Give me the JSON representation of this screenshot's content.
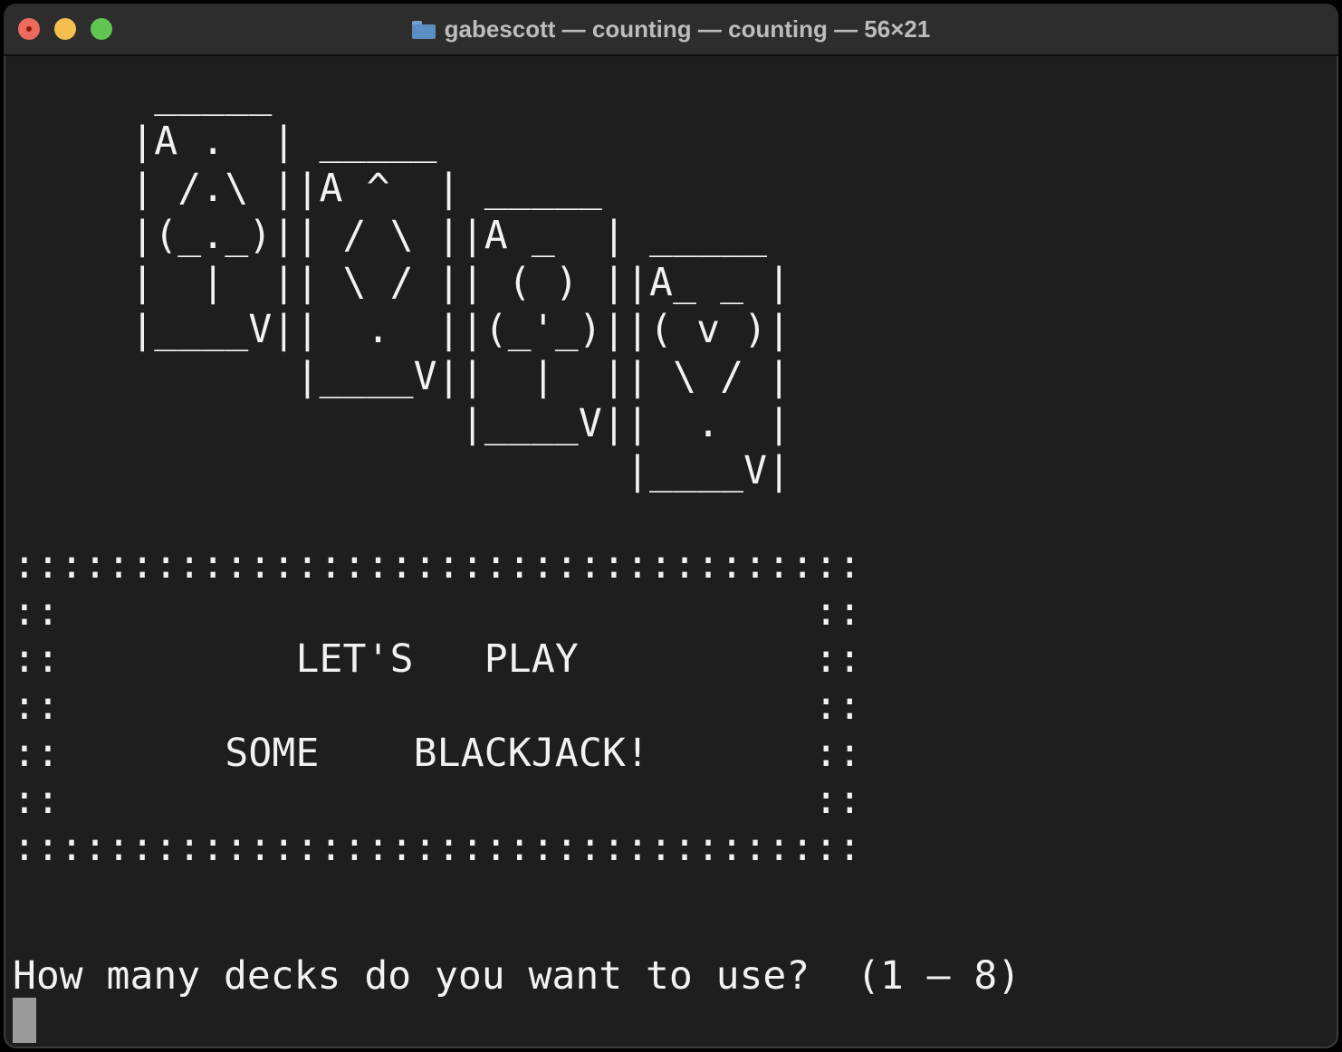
{
  "window": {
    "title": "gabescott — counting — counting — 56×21",
    "title_icon": "folder-icon",
    "buttons": [
      "close-button",
      "minimize-button",
      "maximize-button"
    ]
  },
  "terminal": {
    "ascii_art": "      _____\n     |A .  | _____\n     | /.\\ ||A ^  | _____\n     |(_._)|| / \\ ||A _  | _____\n     |  |  || \\ / || ( ) ||A_ _ |\n     |____V||  .  ||(_'_)||( v )|\n            |____V||  |  || \\ / |\n                   |____V||  .  |\n                          |____V|\n\n::::::::::::::::::::::::::::::::::::\n::                                ::\n::          LET'S   PLAY          ::\n::                                ::\n::       SOME    BLACKJACK!       ::\n::                                ::\n::::::::::::::::::::::::::::::::::::",
    "prompt": "How many decks do you want to use?  (1 – 8)"
  },
  "colors": {
    "background": "#1e1e1e",
    "titlebar": "#2d2d2d",
    "text": "#f2f2f2",
    "close": "#ed6a5e",
    "minimize": "#f5bf4f",
    "maximize": "#61c554"
  }
}
